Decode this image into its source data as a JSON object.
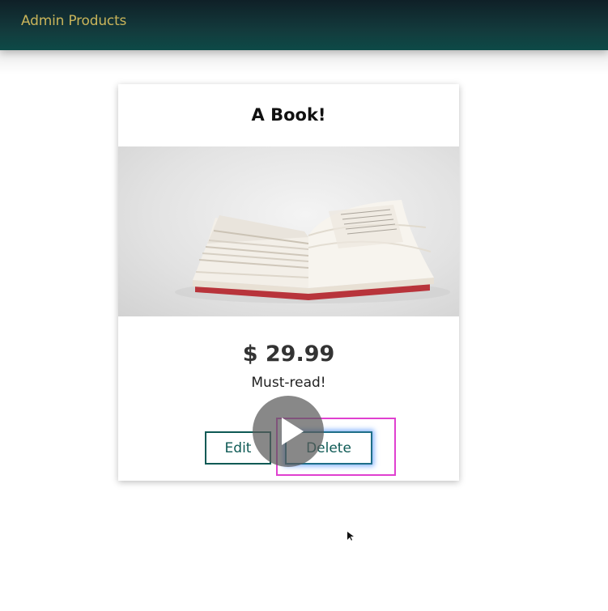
{
  "header": {
    "title": "Admin Products",
    "background_color": "#0f2a2e",
    "title_color": "#c9b45a"
  },
  "product": {
    "title": "A Book!",
    "image_alt": "open-book-image",
    "price": "$ 29.99",
    "description": "Must-read!",
    "edit_label": "Edit",
    "delete_label": "Delete",
    "button_color": "#0e5a55"
  },
  "overlay": {
    "play_icon": "play-icon",
    "highlight_color": "#e040d0"
  }
}
